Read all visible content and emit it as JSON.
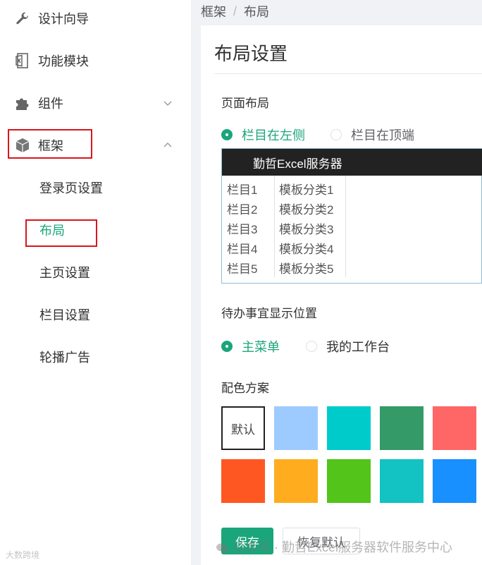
{
  "sidebar": {
    "items": [
      {
        "label": "设计向导",
        "icon": "wrench-icon"
      },
      {
        "label": "功能模块",
        "icon": "excel-file-icon"
      },
      {
        "label": "组件",
        "icon": "puzzle-icon",
        "expanded": false
      },
      {
        "label": "框架",
        "icon": "cube-icon",
        "expanded": true
      }
    ],
    "sub_items": [
      {
        "label": "登录页设置"
      },
      {
        "label": "布局",
        "active": true
      },
      {
        "label": "主页设置"
      },
      {
        "label": "栏目设置"
      },
      {
        "label": "轮播广告"
      }
    ]
  },
  "breadcrumb": {
    "parent": "框架",
    "separator": "/",
    "current": "布局"
  },
  "panel": {
    "title": "布局设置",
    "page_layout": {
      "label": "页面布局",
      "options": [
        {
          "label": "栏目在左侧",
          "checked": true
        },
        {
          "label": "栏目在顶端",
          "checked": false
        }
      ]
    },
    "preview": {
      "header_title": "勤哲Excel服务器",
      "columns": [
        "栏目1",
        "栏目2",
        "栏目3",
        "栏目4",
        "栏目5"
      ],
      "templates": [
        "模板分类1",
        "模板分类2",
        "模板分类3",
        "模板分类4",
        "模板分类5"
      ]
    },
    "todo_position": {
      "label": "待办事宜显示位置",
      "options": [
        {
          "label": "主菜单",
          "checked": true
        },
        {
          "label": "我的工作台",
          "checked": false
        }
      ]
    },
    "color_scheme": {
      "label": "配色方案",
      "default_label": "默认",
      "colors": [
        "#9ecbff",
        "#00cbcb",
        "#349a68",
        "#ff6666",
        "#ff5722",
        "#ffad1f",
        "#52c41a",
        "#13c2c2",
        "#1890ff"
      ]
    },
    "actions": {
      "save": "保存",
      "reset": "恢复默认"
    }
  },
  "watermark": {
    "text": "公众号 · 勤哲Excel服务器软件服务中心",
    "corner": "大数跨境"
  },
  "accent_color": "#1aa57a",
  "highlight_color": "#d9161b"
}
